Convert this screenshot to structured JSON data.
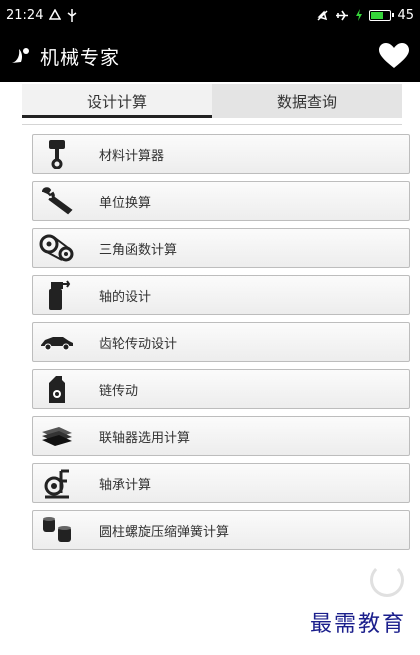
{
  "status_bar": {
    "time": "21:24",
    "battery_level": "45"
  },
  "app_bar": {
    "title": "机械专家"
  },
  "tabs": [
    {
      "label": "设计计算",
      "active": true
    },
    {
      "label": "数据查询",
      "active": false
    }
  ],
  "menu": {
    "items": [
      {
        "label": "材料计算器",
        "icon": "piston-icon"
      },
      {
        "label": "单位换算",
        "icon": "wrench-icon"
      },
      {
        "label": "三角函数计算",
        "icon": "belt-pulley-icon"
      },
      {
        "label": "轴的设计",
        "icon": "spray-bottle-icon"
      },
      {
        "label": "齿轮传动设计",
        "icon": "car-icon"
      },
      {
        "label": "链传动",
        "icon": "oil-bottle-icon"
      },
      {
        "label": "联轴器选用计算",
        "icon": "sheets-icon"
      },
      {
        "label": "轴承计算",
        "icon": "bearing-stand-icon"
      },
      {
        "label": "圆柱螺旋压缩弹簧计算",
        "icon": "spring-cylinders-icon"
      }
    ]
  },
  "watermark": "最需教育",
  "colors": {
    "bar_bg": "#000000",
    "accent_underline": "#222222",
    "watermark": "#1b1f8c"
  }
}
